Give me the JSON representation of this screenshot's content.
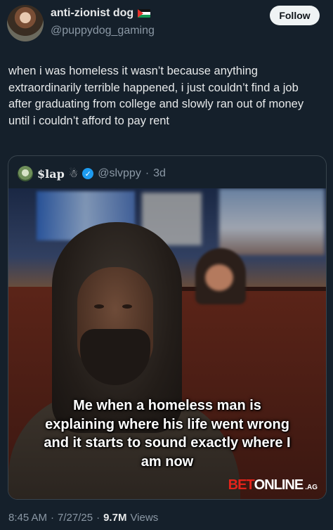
{
  "author": {
    "name": "anti-zionist dog",
    "handle": "@puppydog_gaming"
  },
  "follow_label": "Follow",
  "tweet_text": "when i was homeless it wasn’t because anything extraordinarily terrible happened, i just couldn’t find a job after graduating from college and slowly ran out of money until i couldn’t afford to pay rent",
  "quote": {
    "name": "$lap",
    "handle": "@slvppy",
    "dot": "·",
    "time": "3d",
    "media": {
      "caption": "Me when a homeless man is explaining where his life went wrong and it starts to sound exactly where I am now",
      "watermark": {
        "bet": "BET",
        "online": "ONLINE",
        "ag": ".AG"
      }
    }
  },
  "meta": {
    "time": "8:45 AM",
    "dot1": "·",
    "date": "7/27/25",
    "dot2": "·",
    "views_count": "9.7M",
    "views_label": "Views"
  },
  "colors": {
    "background": "#15202b",
    "text": "#e7e9ea",
    "secondary": "#8b98a5",
    "verified": "#1d9bf0",
    "watermark_red": "#e2231a"
  },
  "icons": [
    "palestine-flag-icon",
    "snowman-icon",
    "verified-badge-icon"
  ]
}
